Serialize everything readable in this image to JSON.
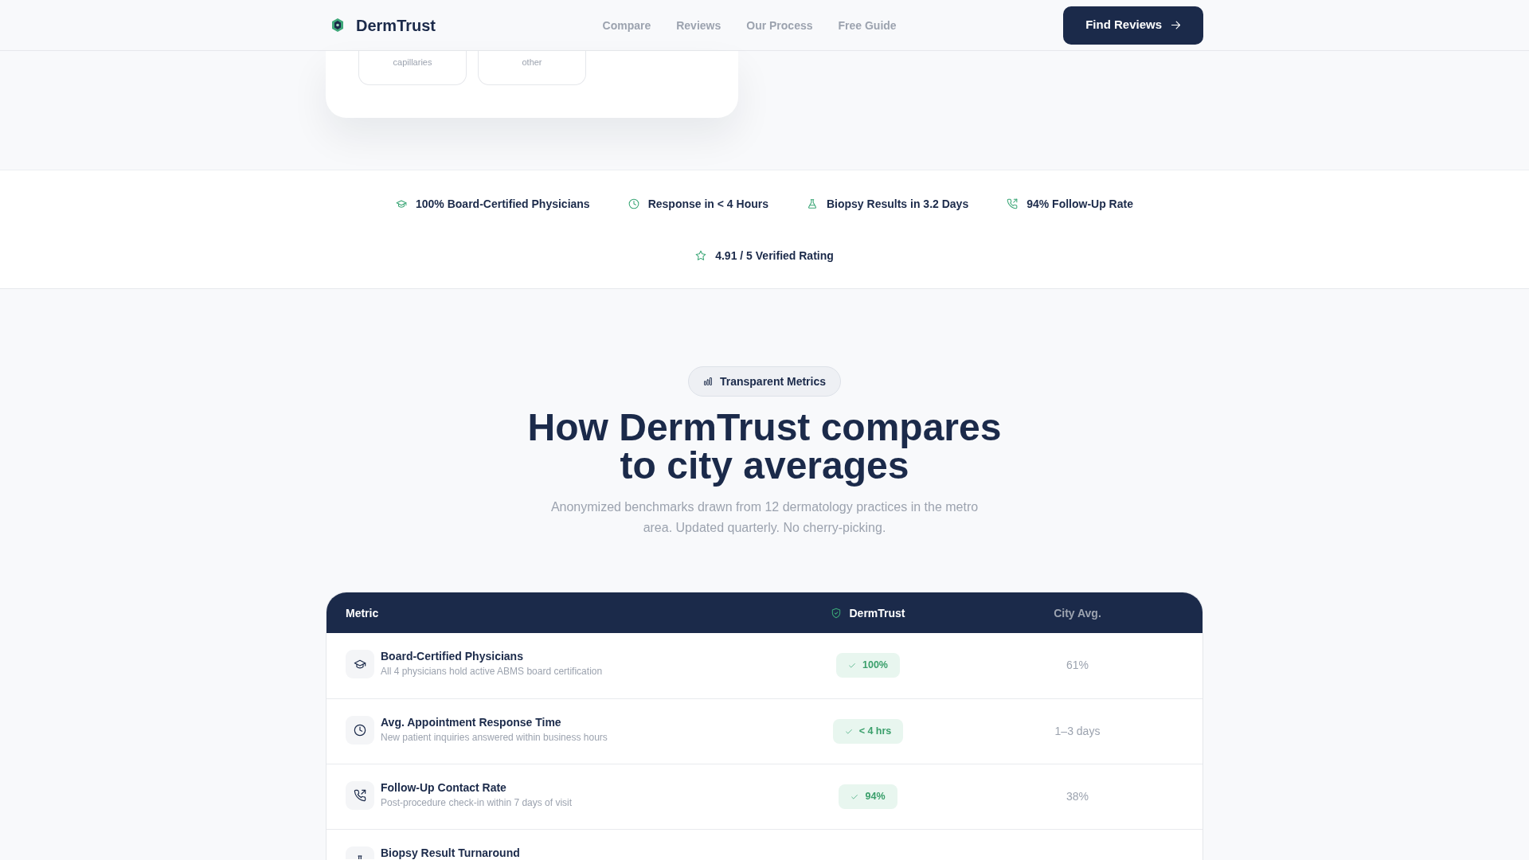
{
  "navbar": {
    "brand": "DermTrust",
    "links": [
      {
        "label": "Compare"
      },
      {
        "label": "Reviews"
      },
      {
        "label": "Our Process"
      },
      {
        "label": "Free Guide"
      }
    ],
    "cta": "Find Reviews"
  },
  "condition_card": {
    "options": [
      {
        "label": "capillaries"
      },
      {
        "label": "other"
      }
    ]
  },
  "trust_stats": [
    {
      "kind": "certified",
      "label": "100% Board-Certified Physicians"
    },
    {
      "kind": "response",
      "label": "Response in < 4 Hours"
    },
    {
      "kind": "biopsy",
      "label": "Biopsy Results in 3.2 Days"
    },
    {
      "kind": "follow_up",
      "label": "94% Follow-Up Rate"
    },
    {
      "kind": "rating",
      "label": "4.91 / 5 Verified Rating"
    }
  ],
  "metrics_section": {
    "tag": "Transparent Metrics",
    "heading": "How DermTrust compares to city averages",
    "subtitle": "Anonymized benchmarks drawn from 12 dermatology practices in the metro area. Updated quarterly. No cherry-picking."
  },
  "comparison_table": {
    "columns": [
      {
        "kind": "metric",
        "label": "Metric"
      },
      {
        "kind": "ours",
        "label": "DermTrust"
      },
      {
        "kind": "city",
        "label": "City Avg."
      }
    ],
    "rows": [
      {
        "kind": "certified",
        "title": "Board-Certified Physicians",
        "description": "All 4 physicians hold active ABMS board certification",
        "dermtrust": "100%",
        "city_avg": "61%"
      },
      {
        "kind": "response",
        "title": "Avg. Appointment Response Time",
        "description": "New patient inquiries answered within business hours",
        "dermtrust": "< 4 hrs",
        "city_avg": "1–3 days"
      },
      {
        "kind": "follow_up",
        "title": "Follow-Up Contact Rate",
        "description": "Post-procedure check-in within 7 days of visit",
        "dermtrust": "94%",
        "city_avg": "38%"
      },
      {
        "kind": "biopsy",
        "title": "Biopsy Result Turnaround"
      }
    ]
  }
}
